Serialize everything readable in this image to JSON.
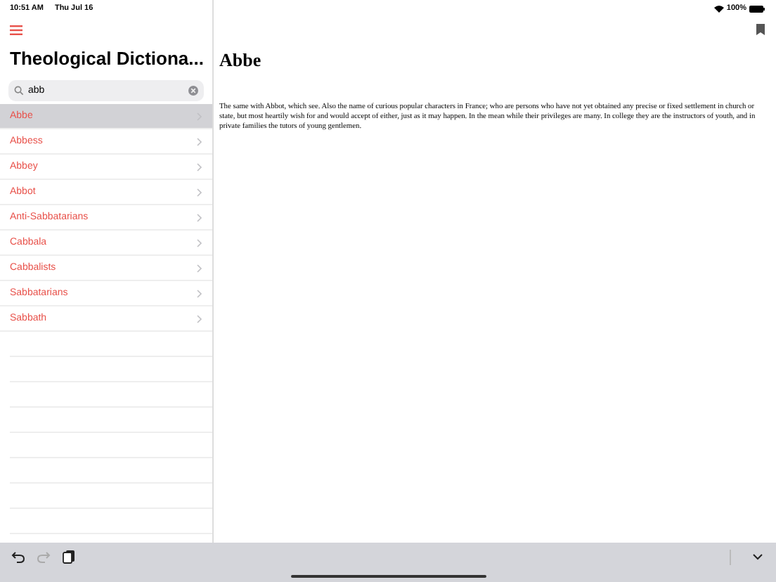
{
  "status_bar": {
    "time": "10:51 AM",
    "date": "Thu Jul 16",
    "battery": "100%"
  },
  "sidebar": {
    "title": "Theological Dictiona...",
    "search": {
      "value": "abb"
    },
    "items": [
      {
        "label": "Abbe",
        "selected": true
      },
      {
        "label": "Abbess",
        "selected": false
      },
      {
        "label": "Abbey",
        "selected": false
      },
      {
        "label": "Abbot",
        "selected": false
      },
      {
        "label": "Anti-Sabbatarians",
        "selected": false
      },
      {
        "label": "Cabbala",
        "selected": false
      },
      {
        "label": "Cabbalists",
        "selected": false
      },
      {
        "label": "Sabbatarians",
        "selected": false
      },
      {
        "label": "Sabbath",
        "selected": false
      }
    ]
  },
  "article": {
    "title": "Abbe",
    "body": "The same with Abbot, which see. Also the name of curious popular characters in France; who are persons who have not yet obtained any precise or fixed settlement in church or state, but most heartily wish for and would accept of either, just as it may happen. In the mean while their privileges are many. In college they are the instructors of youth, and in private families the tutors of young gentlemen."
  }
}
